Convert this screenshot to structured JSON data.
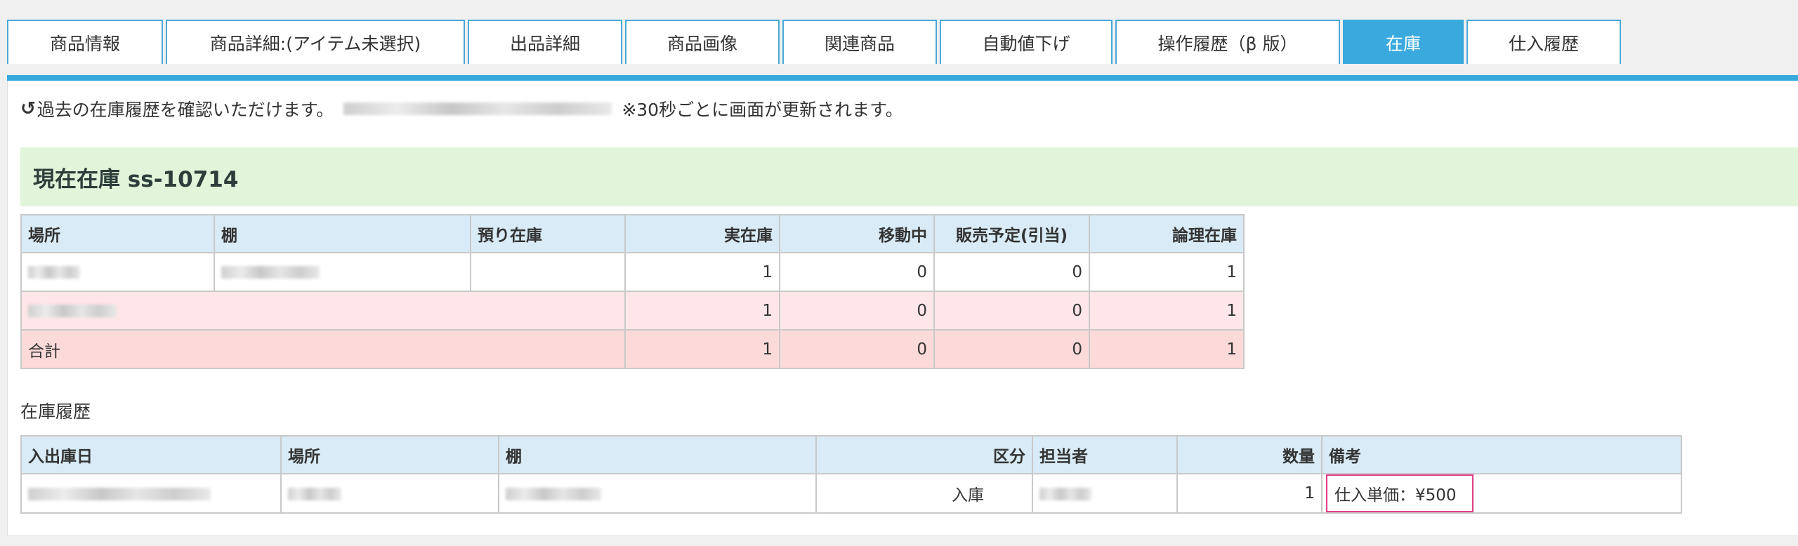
{
  "tabs": [
    {
      "label": "商品情報",
      "active": false
    },
    {
      "label": "商品詳細:(アイテム未選択)",
      "active": false
    },
    {
      "label": "出品詳細",
      "active": false
    },
    {
      "label": "商品画像",
      "active": false
    },
    {
      "label": "関連商品",
      "active": false
    },
    {
      "label": "自動値下げ",
      "active": false
    },
    {
      "label": "操作履歴（β 版）",
      "active": false
    },
    {
      "label": "在庫",
      "active": true
    },
    {
      "label": "仕入履歴",
      "active": false
    }
  ],
  "notice": {
    "icon": "history-icon",
    "text": "過去の在庫履歴を確認いただけます。",
    "suffix": "※30秒ごとに画面が更新されます。"
  },
  "stock": {
    "title": "現在在庫 ss-10714",
    "headers": [
      "場所",
      "棚",
      "預り在庫",
      "実在庫",
      "移動中",
      "販売予定(引当)",
      "論理在庫"
    ],
    "row1": {
      "actual": "1",
      "moving": "0",
      "planned": "0",
      "logical": "1"
    },
    "row2": {
      "actual": "1",
      "moving": "0",
      "planned": "0",
      "logical": "1"
    },
    "total": {
      "label": "合計",
      "actual": "1",
      "moving": "0",
      "planned": "0",
      "logical": "1"
    }
  },
  "history": {
    "title": "在庫履歴",
    "headers": [
      "入出庫日",
      "場所",
      "棚",
      "区分",
      "担当者",
      "数量",
      "備考"
    ],
    "rows": [
      {
        "type": "入庫",
        "qty": "1",
        "note": "仕入単価：¥500"
      }
    ]
  },
  "colors": {
    "accent": "#3aa9de",
    "header_bg": "#d8ebf6",
    "stock_banner": "#e1f5da",
    "row_pink": "#ffe6e8",
    "row_total": "#fddada",
    "highlight_border": "#e0408a"
  }
}
